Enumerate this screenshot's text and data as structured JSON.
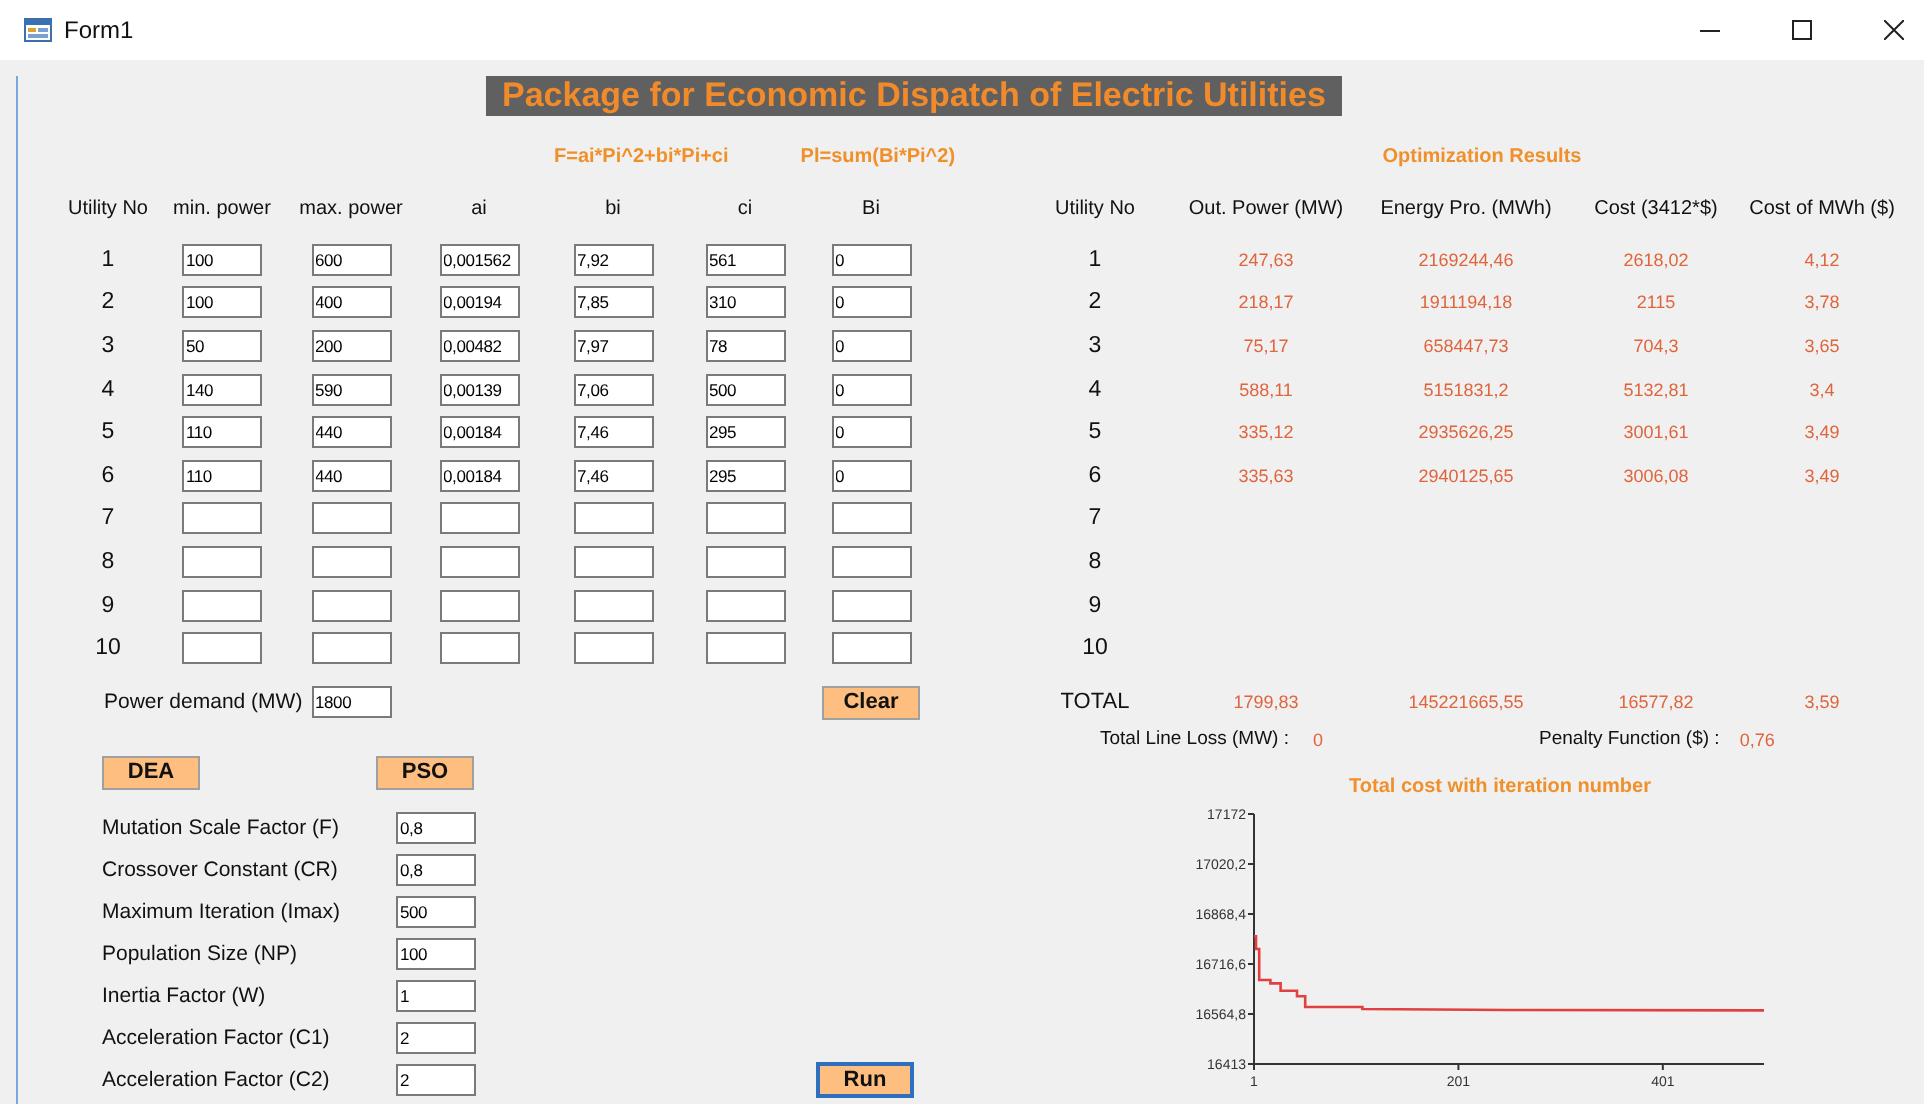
{
  "window": {
    "title": "Form1"
  },
  "banner": "Package for Economic Dispatch of Electric Utilities",
  "formulas": [
    "F=ai*Pi^2+bi*Pi+ci",
    "Pl=sum(Bi*Pi^2)"
  ],
  "input_table": {
    "columns": [
      "Utility No",
      "min. power",
      "max. power",
      "ai",
      "bi",
      "ci",
      "Bi"
    ],
    "rows": [
      {
        "no": "1",
        "values": [
          "100",
          "600",
          "0,001562",
          "7,92",
          "561",
          "0"
        ]
      },
      {
        "no": "2",
        "values": [
          "100",
          "400",
          "0,00194",
          "7,85",
          "310",
          "0"
        ]
      },
      {
        "no": "3",
        "values": [
          "50",
          "200",
          "0,00482",
          "7,97",
          "78",
          "0"
        ]
      },
      {
        "no": "4",
        "values": [
          "140",
          "590",
          "0,00139",
          "7,06",
          "500",
          "0"
        ]
      },
      {
        "no": "5",
        "values": [
          "110",
          "440",
          "0,00184",
          "7,46",
          "295",
          "0"
        ]
      },
      {
        "no": "6",
        "values": [
          "110",
          "440",
          "0,00184",
          "7,46",
          "295",
          "0"
        ]
      },
      {
        "no": "7"
      },
      {
        "no": "8"
      },
      {
        "no": "9"
      },
      {
        "no": "10"
      }
    ]
  },
  "power_demand": {
    "label": "Power demand (MW)",
    "value": "1800"
  },
  "clear_button": {
    "label": "Clear",
    "focused": false
  },
  "method_buttons": [
    {
      "label": "DEA"
    },
    {
      "label": "PSO"
    }
  ],
  "parameters": [
    {
      "label": "Mutation Scale Factor (F)",
      "value": "0,8"
    },
    {
      "label": "Crossover Constant (CR)",
      "value": "0,8"
    },
    {
      "label": "Maximum Iteration (Imax)",
      "value": "500"
    },
    {
      "label": "Population Size (NP)",
      "value": "100"
    },
    {
      "label": "Inertia Factor (W)",
      "value": "1"
    },
    {
      "label": "Acceleration Factor (C1)",
      "value": "2"
    },
    {
      "label": "Acceleration Factor (C2)",
      "value": "2"
    }
  ],
  "run_button": {
    "label": "Run",
    "focused": true
  },
  "results": {
    "title": "Optimization Results",
    "columns": [
      "Utility No",
      "Out. Power (MW)",
      "Energy Pro. (MWh)",
      "Cost (3412*$)",
      "Cost  of MWh ($)"
    ],
    "rows": [
      {
        "no": "1",
        "values": [
          "247,63",
          "2169244,46",
          "2618,02",
          "4,12"
        ]
      },
      {
        "no": "2",
        "values": [
          "218,17",
          "1911194,18",
          "2115",
          "3,78"
        ]
      },
      {
        "no": "3",
        "values": [
          "75,17",
          "658447,73",
          "704,3",
          "3,65"
        ]
      },
      {
        "no": "4",
        "values": [
          "588,11",
          "5151831,2",
          "5132,81",
          "3,4"
        ]
      },
      {
        "no": "5",
        "values": [
          "335,12",
          "2935626,25",
          "3001,61",
          "3,49"
        ]
      },
      {
        "no": "6",
        "values": [
          "335,63",
          "2940125,65",
          "3006,08",
          "3,49"
        ]
      },
      {
        "no": "7"
      },
      {
        "no": "8"
      },
      {
        "no": "9"
      },
      {
        "no": "10"
      }
    ],
    "total": {
      "label": "TOTAL",
      "values": [
        "1799,83",
        "145221665,55",
        "16577,82",
        "3,59"
      ]
    },
    "line_loss": {
      "label": "Total Line Loss (MW) :",
      "value": "0"
    },
    "penalty": {
      "label": "Penalty Function ($)   :",
      "value": "0,76"
    }
  },
  "chart": {
    "chart_data": {
      "type": "line",
      "title": "Total cost with iteration number",
      "x": [
        1,
        3,
        3,
        6,
        6,
        17,
        17,
        27,
        27,
        43,
        43,
        51,
        51,
        107,
        107,
        250,
        500
      ],
      "series": [
        {
          "color": "#e04040",
          "values": [
            16801,
            16801,
            16762,
            16762,
            16668,
            16668,
            16658,
            16658,
            16635,
            16635,
            16619,
            16619,
            16586,
            16586,
            16580,
            16577,
            16576
          ]
        }
      ],
      "xlim": [
        1,
        500
      ],
      "ylim": [
        16413,
        17172
      ],
      "xticks": [
        1,
        201,
        401
      ],
      "yticks": [
        16413,
        {
          "value": 16564.8,
          "label": "16564,8"
        },
        {
          "value": 16716.6,
          "label": "16716,6"
        },
        {
          "value": 16868.4,
          "label": "16868,4"
        },
        {
          "value": 17020.2,
          "label": "17020,2"
        },
        17172
      ]
    }
  }
}
